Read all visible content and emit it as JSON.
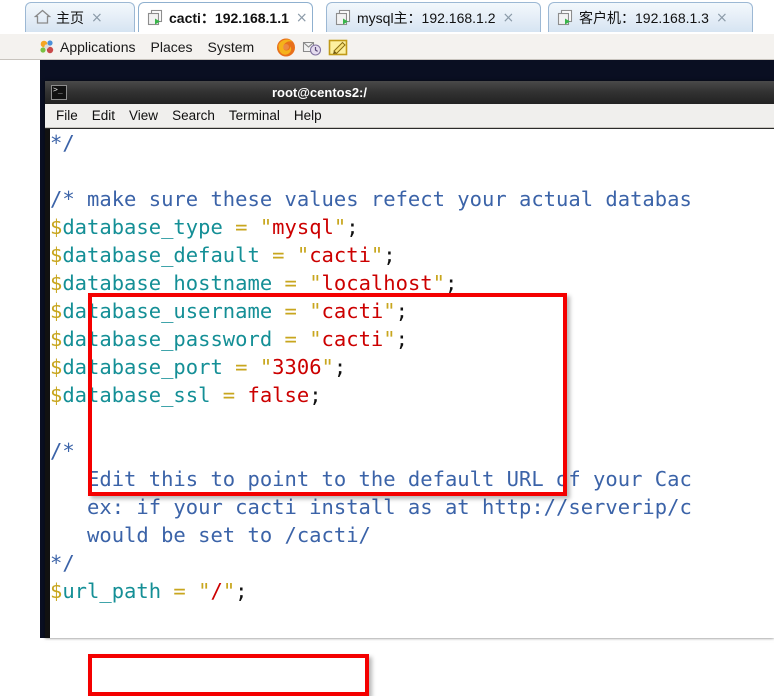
{
  "browser": {
    "tabs": [
      {
        "label": "主页",
        "icon": "home-icon",
        "active": false,
        "close": "×"
      },
      {
        "label": "cacti：192.168.1.1",
        "icon": "remote-desktop-icon",
        "active": true,
        "close": "×"
      },
      {
        "label": "mysql主：192.168.1.2",
        "icon": "remote-desktop-icon",
        "active": false,
        "close": "×"
      },
      {
        "label": "客户机：192.168.1.3",
        "icon": "remote-desktop-icon",
        "active": false,
        "close": "×"
      }
    ]
  },
  "gnome_panel": {
    "menus": [
      "Applications",
      "Places",
      "System"
    ],
    "launchers": [
      "firefox-icon",
      "evolution-mail-icon",
      "text-editor-icon"
    ]
  },
  "terminal": {
    "title": "root@centos2:/",
    "window_icon": "terminal-icon",
    "menus": [
      "File",
      "Edit",
      "View",
      "Search",
      "Terminal",
      "Help"
    ],
    "lines": [
      {
        "type": "comment",
        "text": "*/"
      },
      {
        "type": "blank",
        "text": ""
      },
      {
        "type": "comment",
        "text": "/* make sure these values refect your actual databas"
      },
      {
        "type": "assign",
        "sigil": "$",
        "name": "database_type",
        "eq": " = ",
        "quote": "\"",
        "value": "mysql",
        "end": ";"
      },
      {
        "type": "assign",
        "sigil": "$",
        "name": "database_default",
        "eq": " = ",
        "quote": "\"",
        "value": "cacti",
        "end": ";"
      },
      {
        "type": "assign",
        "sigil": "$",
        "name": "database_hostname",
        "eq": " = ",
        "quote": "\"",
        "value": "localhost",
        "end": ";"
      },
      {
        "type": "assign",
        "sigil": "$",
        "name": "database_username",
        "eq": " = ",
        "quote": "\"",
        "value": "cacti",
        "end": ";"
      },
      {
        "type": "assign",
        "sigil": "$",
        "name": "database_password",
        "eq": " = ",
        "quote": "\"",
        "value": "cacti",
        "end": ";"
      },
      {
        "type": "assign",
        "sigil": "$",
        "name": "database_port",
        "eq": " = ",
        "quote": "\"",
        "value": "3306",
        "end": ";"
      },
      {
        "type": "assign",
        "sigil": "$",
        "name": "database_ssl",
        "eq": " = ",
        "quote": "",
        "value": "false",
        "end": ";"
      },
      {
        "type": "blank",
        "text": ""
      },
      {
        "type": "comment",
        "text": "/*"
      },
      {
        "type": "comment",
        "text": "   Edit this to point to the default URL of your Cac"
      },
      {
        "type": "comment",
        "text": "   ex: if your cacti install as at http://serverip/c"
      },
      {
        "type": "comment",
        "text": "   would be set to /cacti/"
      },
      {
        "type": "comment",
        "text": "*/"
      },
      {
        "type": "assign",
        "sigil": "$",
        "name": "url_path",
        "eq": " = ",
        "quote": "\"",
        "value": "/",
        "end": ";"
      }
    ]
  },
  "annotations": {
    "box_database_block": "red-highlight-box",
    "box_url_path": "red-highlight-box",
    "color": "#f40000"
  },
  "colors": {
    "comment": "#3b63a8",
    "variable": "#148f96",
    "sigil": "#c8a61e",
    "string": "#cc0000",
    "annotation": "#f40000",
    "desktop": "#0a0f22"
  }
}
